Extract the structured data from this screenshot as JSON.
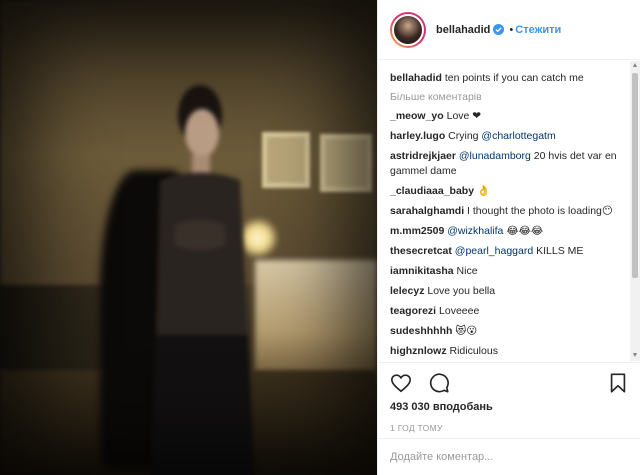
{
  "post": {
    "username": "bellahadid",
    "follow_label": "Стежити",
    "caption_user": "bellahadid",
    "caption_text": "ten points if you can catch me",
    "more_comments": "Більше коментарів",
    "likes": "493 030 вподобань",
    "time": "1 год тому",
    "add_comment_placeholder": "Додайте коментар..."
  },
  "comments": [
    {
      "user": "_meow_yo",
      "text": "Love ❤"
    },
    {
      "user": "harley.lugo",
      "text": "Crying ",
      "mention": "@charlottegatm"
    },
    {
      "user": "astridrejkjaer",
      "mention": "@lunadamborg",
      "text": " 20 hvis det var en gammel dame"
    },
    {
      "user": "_claudiaaa_baby",
      "text": "👌"
    },
    {
      "user": "sarahalghamdi",
      "text": "I thought the photo is loading😶"
    },
    {
      "user": "m.mm2509",
      "mention": "@wizkhalifa",
      "text": " 😂😂😂"
    },
    {
      "user": "thesecretcat",
      "mention": "@pearl_haggard",
      "text": " KILLS ME"
    },
    {
      "user": "iamnikitasha",
      "text": "Nice"
    },
    {
      "user": "lelecyz",
      "text": "Love you bella"
    },
    {
      "user": "teagorezi",
      "text": "Loveeee"
    },
    {
      "user": "sudeshhhhh",
      "text": "😻😮"
    },
    {
      "user": "highznlowz",
      "text": "Ridiculous"
    }
  ],
  "icons": {
    "like": "heart-icon",
    "comment": "comment-icon",
    "save": "bookmark-icon",
    "verified": "verified-badge-icon"
  },
  "colors": {
    "link": "#3897f0",
    "mention": "#003569",
    "muted": "#999999"
  }
}
